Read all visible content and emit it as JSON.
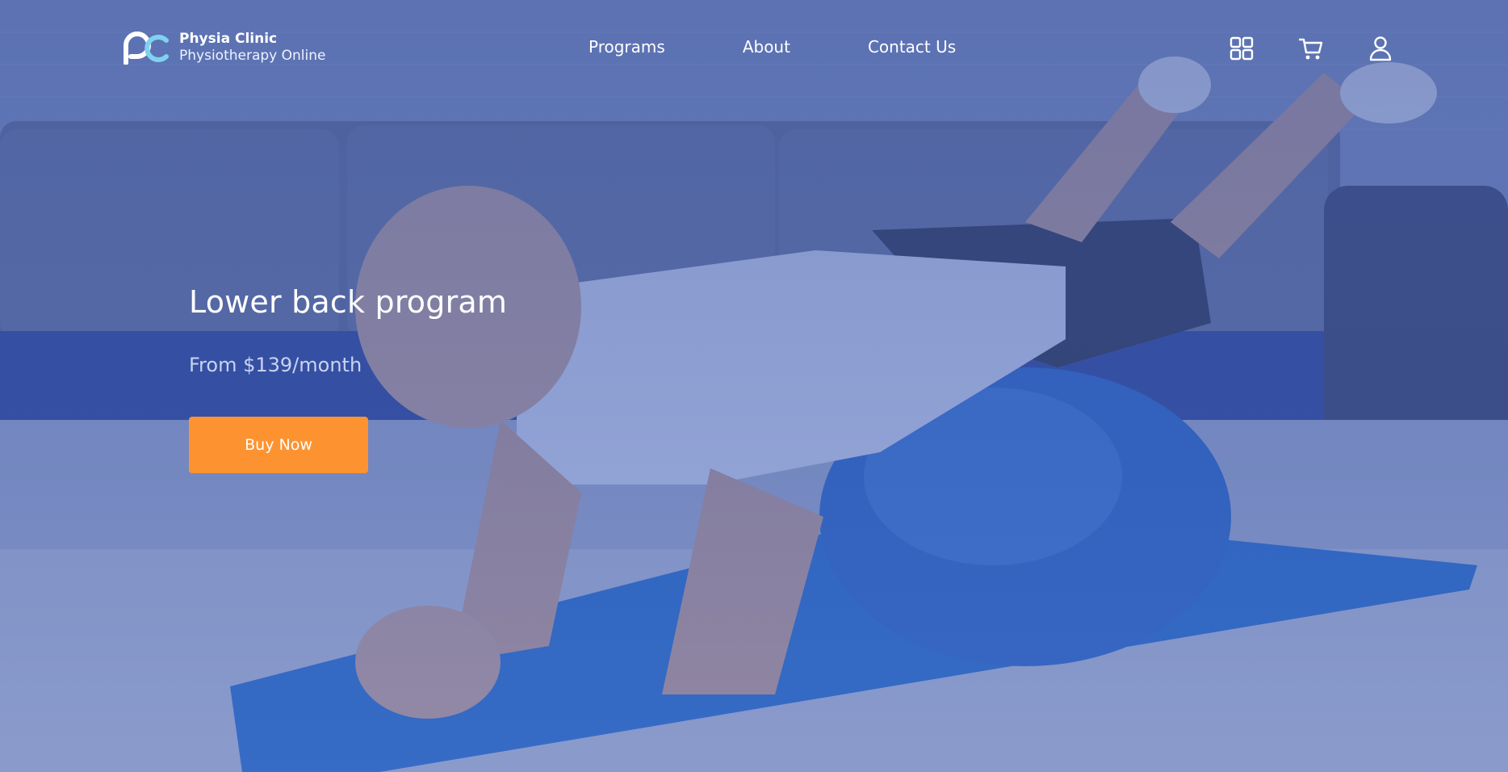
{
  "brand": {
    "name": "Physia Clinic",
    "tagline": "Physiotherapy Online",
    "logo_icon": "pc-logo-icon"
  },
  "nav": {
    "items": [
      {
        "label": "Programs"
      },
      {
        "label": "About"
      },
      {
        "label": "Contact Us"
      }
    ],
    "icons": [
      "grid-icon",
      "cart-icon",
      "user-icon"
    ]
  },
  "hero": {
    "title": "Lower back program",
    "price": "From $139/month",
    "cta_label": "Buy Now",
    "background": "photo of man exercising on blue fitness ball with blue overlay"
  },
  "colors": {
    "overlay": "#4660af",
    "cta": "#fd9330",
    "text": "#ffffff",
    "price_text": "#c9d3f0"
  }
}
